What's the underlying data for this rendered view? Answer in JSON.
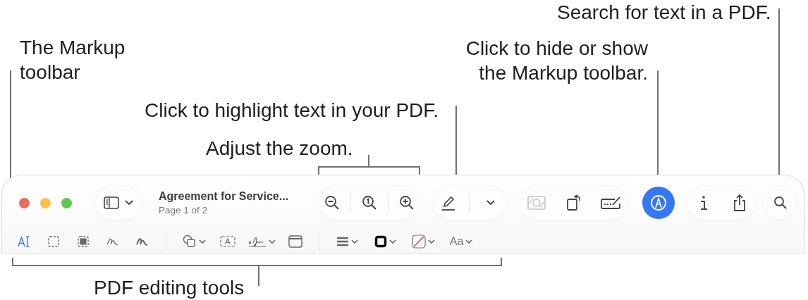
{
  "callouts": [
    {
      "kind": "search",
      "text": "Search for text in a PDF."
    },
    {
      "kind": "markup",
      "text": "The Markup toolbar"
    },
    {
      "kind": "toggle",
      "text": "Click to hide or show the Markup toolbar."
    },
    {
      "kind": "highlight",
      "text": "Click to highlight text in your PDF."
    },
    {
      "kind": "zoom",
      "text": "Adjust the zoom."
    },
    {
      "kind": "tools",
      "text": "PDF editing tools"
    }
  ],
  "window": {
    "title": "Agreement for Service...",
    "subtitle": "Page 1 of 2"
  },
  "markup_toggle": {
    "selected": true
  },
  "markup_tools": [
    {
      "kind": "text-select",
      "selected": true
    },
    {
      "kind": "rect-select",
      "selected": false
    },
    {
      "kind": "redact",
      "selected": false
    },
    {
      "kind": "sketch",
      "selected": false
    },
    {
      "kind": "draw",
      "selected": false
    },
    {
      "kind": "divider"
    },
    {
      "kind": "shapes",
      "selected": false
    },
    {
      "kind": "text-box",
      "selected": false
    },
    {
      "kind": "sign",
      "selected": false
    },
    {
      "kind": "note",
      "selected": false
    },
    {
      "kind": "divider"
    },
    {
      "kind": "line-style",
      "selected": false
    },
    {
      "kind": "border-color",
      "selected": false
    },
    {
      "kind": "fill-color",
      "selected": false
    },
    {
      "kind": "font",
      "label": "Aa",
      "selected": false
    }
  ]
}
